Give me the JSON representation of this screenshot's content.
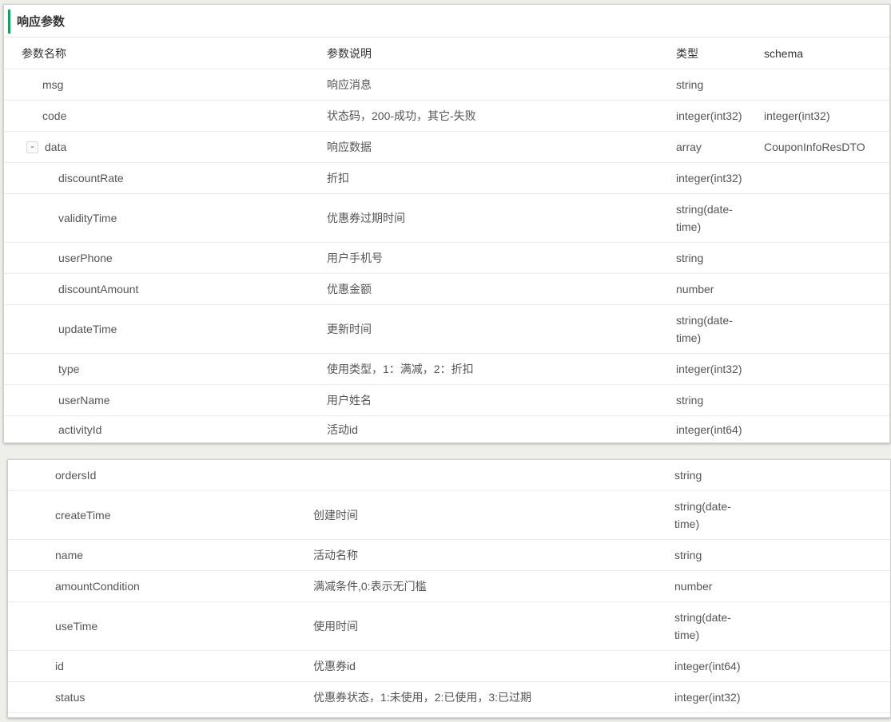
{
  "section_title": "响应参数",
  "headers": {
    "name": "参数名称",
    "desc": "参数说明",
    "type": "类型",
    "schema": "schema"
  },
  "top_rows": [
    {
      "name": "msg",
      "desc": "响应消息",
      "type": "string",
      "schema": ""
    },
    {
      "name": "code",
      "desc": "状态码，200-成功，其它-失败",
      "type": "integer(int32)",
      "schema": "integer(int32)"
    },
    {
      "name": "data",
      "desc": "响应数据",
      "type": "array",
      "schema": "CouponInfoResDTO",
      "toggle": "-"
    },
    {
      "name": "discountRate",
      "desc": "折扣",
      "type": "integer(int32)",
      "schema": ""
    },
    {
      "name": "validityTime",
      "desc": "优惠券过期时间",
      "type": "string(date-time)",
      "schema": ""
    },
    {
      "name": "userPhone",
      "desc": "用户手机号",
      "type": "string",
      "schema": ""
    },
    {
      "name": "discountAmount",
      "desc": "优惠金额",
      "type": "number",
      "schema": ""
    },
    {
      "name": "updateTime",
      "desc": "更新时间",
      "type": "string(date-time)",
      "schema": ""
    },
    {
      "name": "type",
      "desc": "使用类型，1：满减，2：折扣",
      "type": "integer(int32)",
      "schema": ""
    },
    {
      "name": "userName",
      "desc": "用户姓名",
      "type": "string",
      "schema": ""
    },
    {
      "name": "activityId",
      "desc": "活动id",
      "type": "integer(int64)",
      "schema": ""
    }
  ],
  "bottom_rows": [
    {
      "name": "ordersId",
      "desc": "",
      "type": "string",
      "schema": ""
    },
    {
      "name": "createTime",
      "desc": "创建时间",
      "type": "string(date-time)",
      "schema": ""
    },
    {
      "name": "name",
      "desc": "活动名称",
      "type": "string",
      "schema": ""
    },
    {
      "name": "amountCondition",
      "desc": "满减条件,0:表示无门槛",
      "type": "number",
      "schema": ""
    },
    {
      "name": "useTime",
      "desc": "使用时间",
      "type": "string(date-time)",
      "schema": ""
    },
    {
      "name": "id",
      "desc": "优惠券id",
      "type": "integer(int64)",
      "schema": ""
    },
    {
      "name": "status",
      "desc": "优惠券状态，1:未使用，2:已使用，3:已过期",
      "type": "integer(int32)",
      "schema": ""
    }
  ]
}
